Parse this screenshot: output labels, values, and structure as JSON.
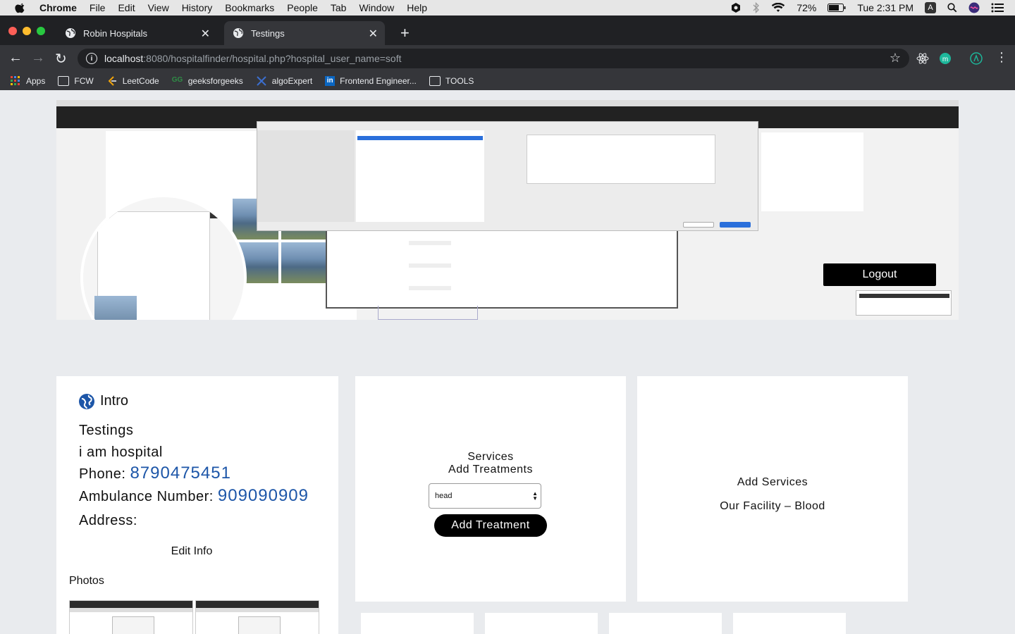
{
  "menubar": {
    "app": "Chrome",
    "items": [
      "File",
      "Edit",
      "View",
      "History",
      "Bookmarks",
      "People",
      "Tab",
      "Window",
      "Help"
    ],
    "battery": "72%",
    "clock": "Tue 2:31 PM"
  },
  "tabs": [
    {
      "title": "Robin Hospitals"
    },
    {
      "title": "Testings"
    }
  ],
  "address": {
    "host": "localhost",
    "rest": ":8080/hospitalfinder/hospital.php?hospital_user_name=soft"
  },
  "bookmarks": [
    "Apps",
    "FCW",
    "LeetCode",
    "geeksforgeeks",
    "algoExpert",
    "Frontend Engineer...",
    "TOOLS"
  ],
  "header": {
    "logout_label": "Logout"
  },
  "intro": {
    "heading": "Intro",
    "name": "Testings",
    "description": "i am hospital",
    "phone_label": "Phone:",
    "phone": "8790475451",
    "ambulance_label": "Ambulance Number:",
    "ambulance": "909090909",
    "address_label": "Address:",
    "address": "",
    "edit_label": "Edit Info",
    "photos_label": "Photos"
  },
  "services": {
    "title": "Services",
    "subtitle": "Add Treatments",
    "selected_option": "head",
    "button_label": "Add Treatment"
  },
  "facility": {
    "add_label": "Add Services",
    "facility_text": "Our Facility – Blood"
  },
  "colors": {
    "link_value": "#1d56a8",
    "button_bg": "#000000",
    "page_bg": "#e9ebee"
  }
}
